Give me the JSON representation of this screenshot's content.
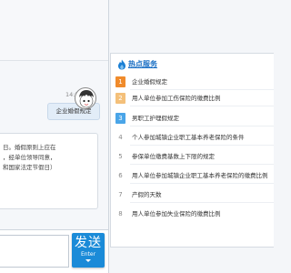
{
  "chat": {
    "timestamp": "14:50:52",
    "user_message": "企业婚假规定",
    "reply_lines": [
      "日。婚假原则上应在",
      "，经单位领导同意，",
      "和国家法定节假日）"
    ],
    "send_label": "发送",
    "send_sub": "Enter"
  },
  "hot": {
    "title": "热点服务",
    "items": [
      {
        "num": "1",
        "label": "企业婚假规定"
      },
      {
        "num": "2",
        "label": "用人单位参加工伤保险的缴费比例"
      },
      {
        "num": "3",
        "label": "男职工护理假规定"
      },
      {
        "num": "4",
        "label": "个人参加城镇企业职工基本养老保险的条件"
      },
      {
        "num": "5",
        "label": "参保单位缴费基数上下限的规定"
      },
      {
        "num": "6",
        "label": "用人单位参加城镇企业职工基本养老保险的缴费比例"
      },
      {
        "num": "7",
        "label": "产假的天数"
      },
      {
        "num": "8",
        "label": "用人单位参加失业保险的缴费比例"
      }
    ]
  },
  "colors": {
    "accent": "#1b8bd8",
    "title_blue": "#1a6fc4",
    "rank1": "#f08b2c",
    "rank2": "#f4c07a",
    "rank3": "#4aa5e8"
  },
  "icons": {
    "hot": "flame-icon",
    "avatar": "cartoon-avatar",
    "send_caret": "caret-down-icon"
  }
}
